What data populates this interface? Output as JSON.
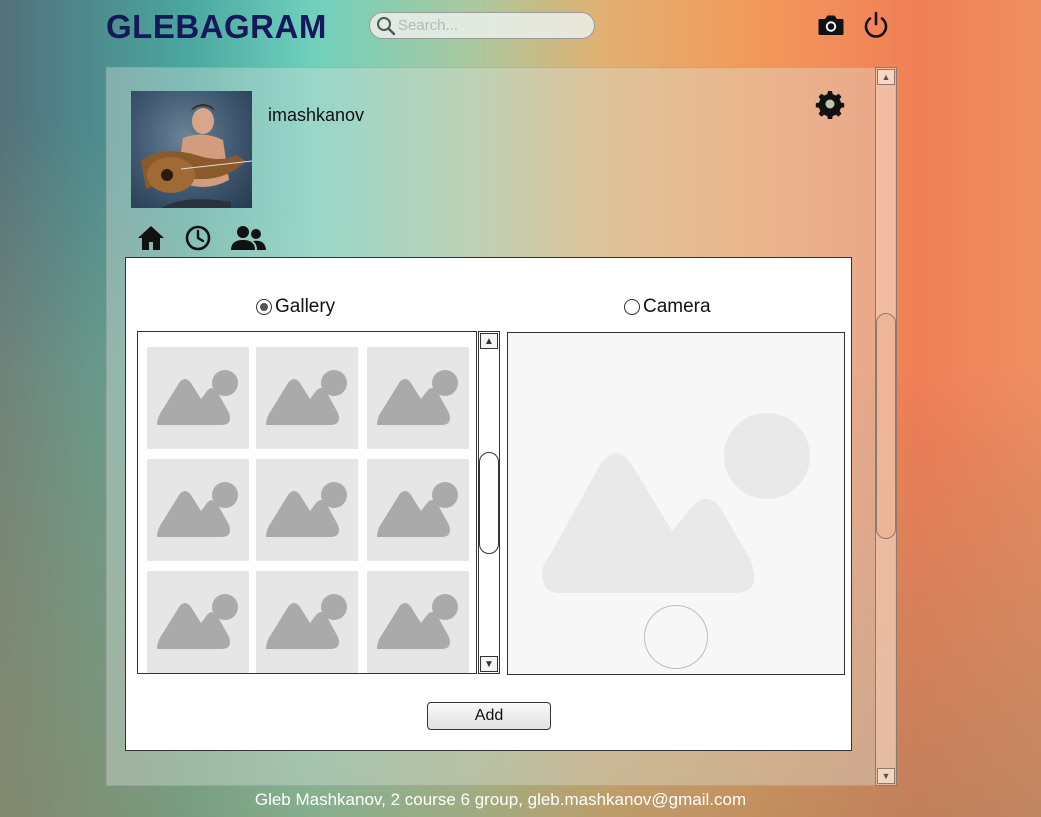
{
  "header": {
    "logo": "GLEBAGRAM",
    "search_placeholder": "Search...",
    "camera_icon": "camera-icon",
    "power_icon": "power-icon"
  },
  "profile": {
    "username": "imashkanov",
    "avatar": "avatar",
    "settings_icon": "gear-icon",
    "nav": [
      "home-icon",
      "clock-icon",
      "people-icon"
    ]
  },
  "upload_dialog": {
    "source_options": [
      {
        "label": "Gallery",
        "selected": true
      },
      {
        "label": "Camera",
        "selected": false
      }
    ],
    "gallery_thumbnails": 9,
    "add_label": "Add"
  },
  "footer": {
    "text": "Gleb Mashkanov, 2 course 6 group, gleb.mashkanov@gmail.com"
  },
  "colors": {
    "logo": "#16185a",
    "panel_border": "#333333",
    "placeholder_bg": "#e6e6e6",
    "placeholder_shape": "#aaaaaa"
  }
}
